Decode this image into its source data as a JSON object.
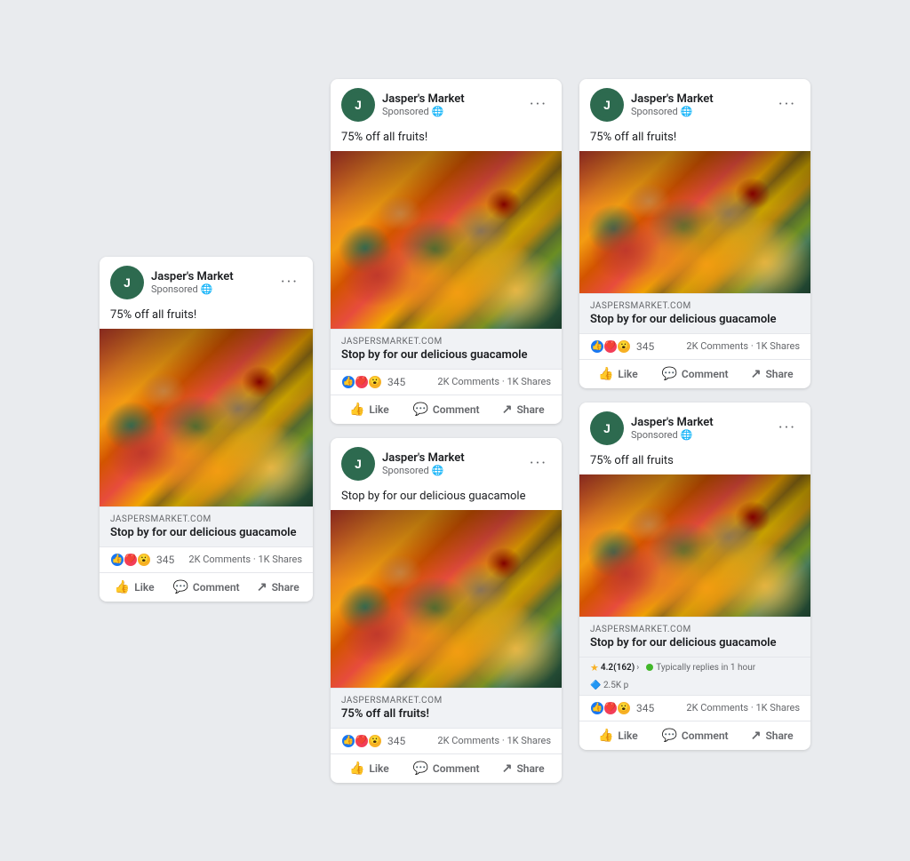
{
  "brand": {
    "name": "Jasper's Market",
    "sponsored": "Sponsored",
    "avatar_letter": "J",
    "domain": "JASPERSMARKET.COM",
    "globe": "🌐"
  },
  "ads": {
    "caption_fruits": "75% off all fruits!",
    "caption_guac": "Stop by for our delicious guacamole",
    "caption_fruits2": "75% off all fruits",
    "link_title": "Stop by for our delicious guacamole",
    "reactions_count": "345",
    "stats_comments": "2K Comments",
    "stats_shares": "1K Shares",
    "action_like": "Like",
    "action_comment": "Comment",
    "action_share": "Share",
    "rating": "4.2(162)",
    "reply_text": "Typically replies in 1 hour",
    "people_count": "2.5K p",
    "chevron": "›"
  }
}
